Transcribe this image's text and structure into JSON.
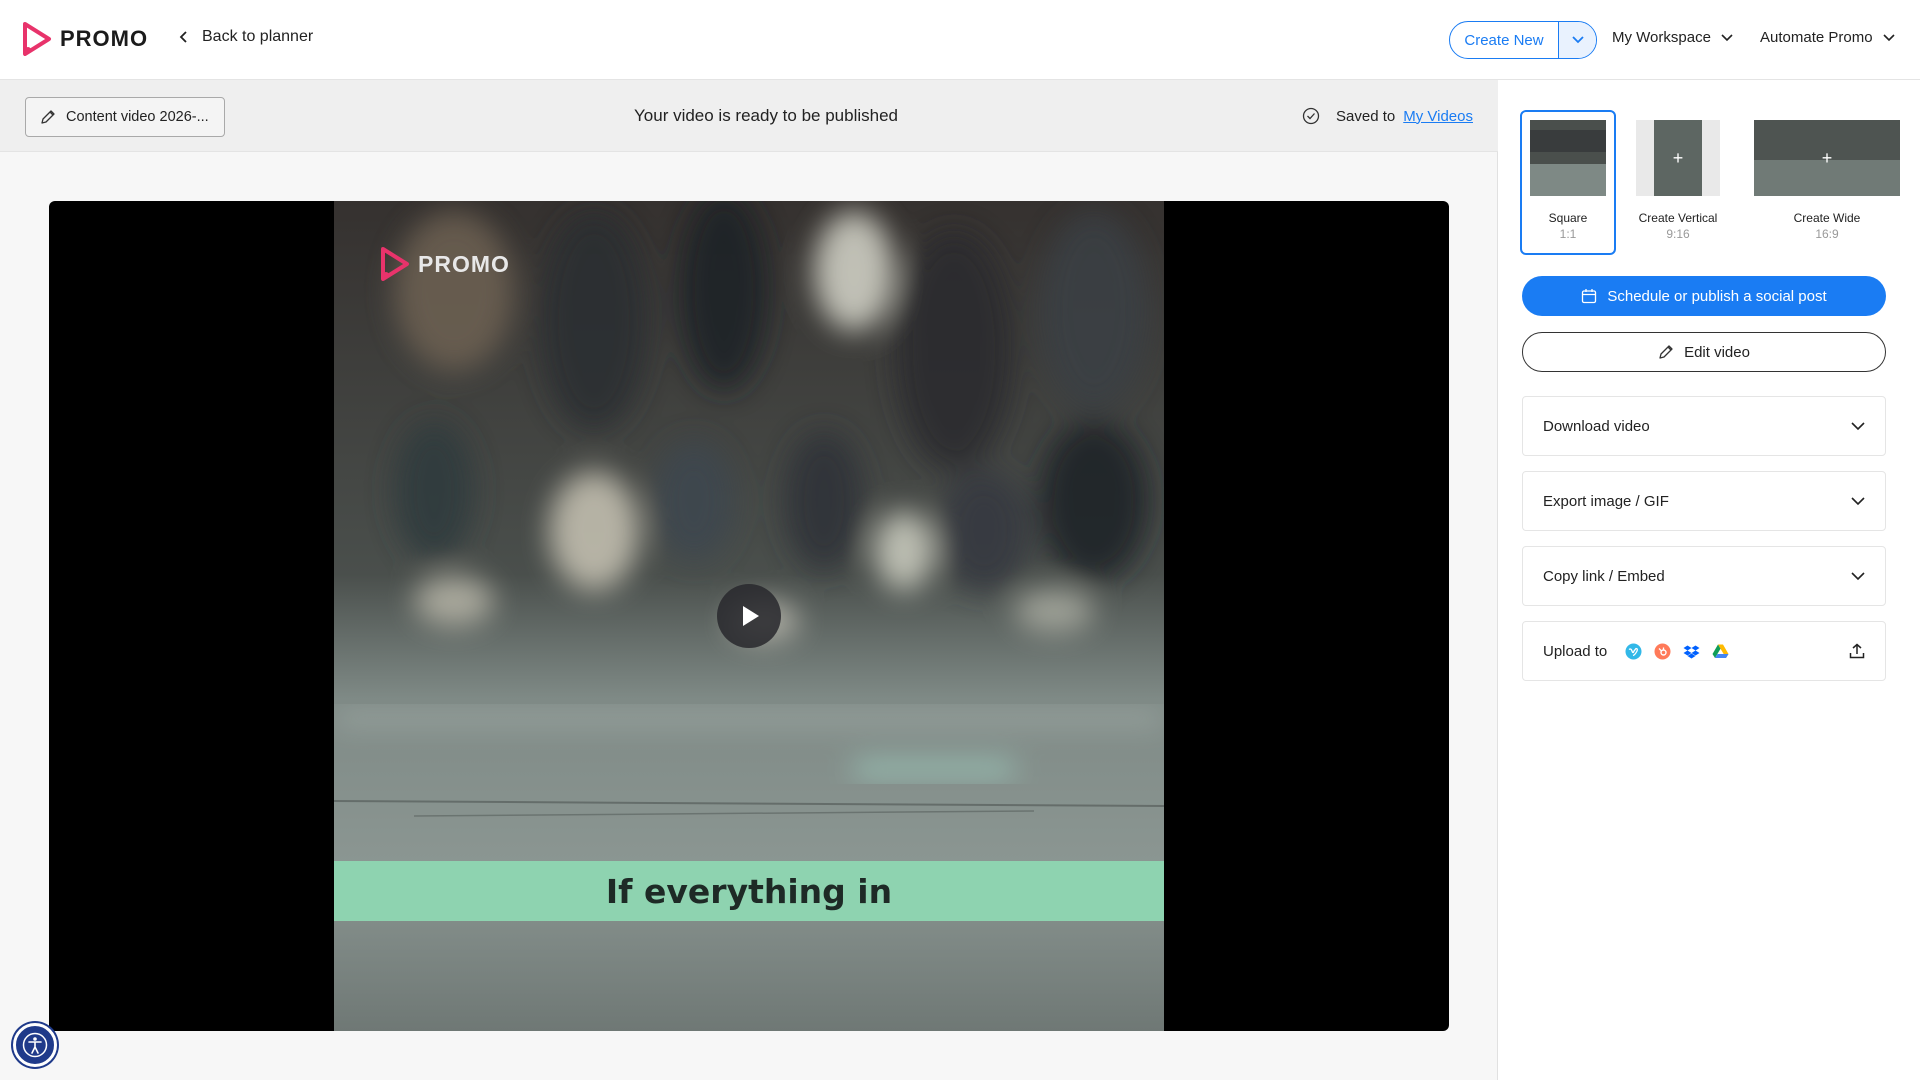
{
  "header": {
    "logo_text": "PROMO",
    "back_label": "Back to planner",
    "create_new_label": "Create New",
    "workspace_label": "My Workspace",
    "automate_label": "Automate Promo"
  },
  "status": {
    "video_name": "Content video 2026-...",
    "ready_message": "Your video is ready to be published",
    "saved_prefix": "Saved to",
    "saved_link": "My Videos"
  },
  "player": {
    "watermark": "PROMO",
    "caption": "If everything in"
  },
  "formats": [
    {
      "label": "Square",
      "ratio": "1:1",
      "selected": true
    },
    {
      "label": "Create Vertical",
      "ratio": "9:16",
      "selected": false
    },
    {
      "label": "Create Wide",
      "ratio": "16:9",
      "selected": false
    }
  ],
  "actions": {
    "schedule_label": "Schedule or publish a social post",
    "edit_label": "Edit video"
  },
  "accordions": {
    "download": "Download video",
    "export": "Export image / GIF",
    "copy": "Copy link / Embed",
    "upload": "Upload to"
  },
  "upload_targets": [
    "vimeo-icon",
    "hubspot-icon",
    "dropbox-icon",
    "google-drive-icon"
  ],
  "colors": {
    "accent": "#1a7cf3",
    "caption_band": "#8ed3b0",
    "logo_pink": "#e8336b"
  }
}
